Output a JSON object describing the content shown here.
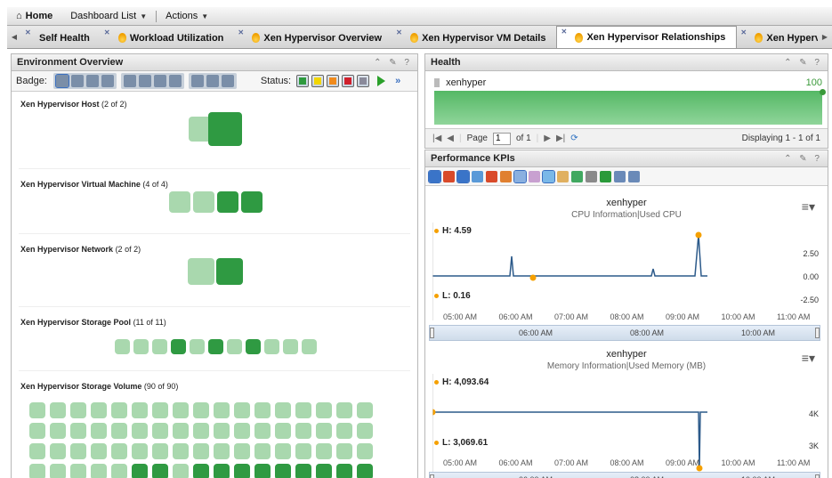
{
  "topbar": {
    "home": "Home",
    "dashboard_list": "Dashboard List",
    "actions": "Actions"
  },
  "tabs": [
    {
      "label": "Self Health",
      "icon": false
    },
    {
      "label": "Workload Utilization",
      "icon": true
    },
    {
      "label": "Xen Hypervisor Overview",
      "icon": true
    },
    {
      "label": "Xen Hypervisor VM Details",
      "icon": true
    },
    {
      "label": "Xen Hypervisor Relationships",
      "icon": true,
      "active": true
    },
    {
      "label": "Xen Hypervisor Host Details",
      "icon": true
    }
  ],
  "env": {
    "title": "Environment Overview",
    "badge_label": "Badge:",
    "status_label": "Status:",
    "status_colors": [
      "#2e9a3e",
      "#f2d600",
      "#f08a1c",
      "#d0202c",
      "#8a8a9a"
    ],
    "sections": [
      {
        "name": "Xen Hypervisor Host",
        "count": "(2 of 2)",
        "tiles": [
          "light",
          "dark"
        ]
      },
      {
        "name": "Xen Hypervisor Virtual Machine",
        "count": "(4 of 4)",
        "tiles": [
          "light",
          "light",
          "dark",
          "dark"
        ]
      },
      {
        "name": "Xen Hypervisor Network",
        "count": "(2 of 2)",
        "tiles": [
          "light",
          "dark"
        ]
      },
      {
        "name": "Xen Hypervisor Storage Pool",
        "count": "(11 of 11)",
        "tiles": [
          "light",
          "light",
          "light",
          "dark",
          "light",
          "dark",
          "light",
          "dark",
          "light",
          "light",
          "light"
        ]
      },
      {
        "name": "Xen Hypervisor Storage Volume",
        "count": "(90 of 90)"
      }
    ]
  },
  "health": {
    "title": "Health",
    "resource": "xenhyper",
    "value": "100",
    "pager_page_label": "Page",
    "pager_page": "1",
    "pager_of": "of 1",
    "pager_display": "Displaying 1 - 1 of 1"
  },
  "kpi": {
    "title": "Performance KPIs",
    "charts": [
      {
        "resource": "xenhyper",
        "metric": "CPU Information|Used CPU",
        "high": "H: 4.59",
        "low": "L: 0.16",
        "yticks": [
          "2.50",
          "0.00",
          "-2.50"
        ],
        "xticks": [
          "05:00 AM",
          "06:00 AM",
          "07:00 AM",
          "08:00 AM",
          "09:00 AM",
          "10:00 AM",
          "11:00 AM"
        ],
        "nav_ticks": [
          "06:00 AM",
          "08:00 AM",
          "10:00 AM"
        ]
      },
      {
        "resource": "xenhyper",
        "metric": "Memory Information|Used Memory (MB)",
        "high": "H: 4,093.64",
        "low": "L: 3,069.61",
        "yticks": [
          "4K",
          "3K"
        ],
        "xticks": [
          "05:00 AM",
          "06:00 AM",
          "07:00 AM",
          "08:00 AM",
          "09:00 AM",
          "10:00 AM",
          "11:00 AM"
        ],
        "nav_ticks": [
          "06:00 AM",
          "08:00 AM",
          "10:00 AM"
        ]
      }
    ]
  }
}
